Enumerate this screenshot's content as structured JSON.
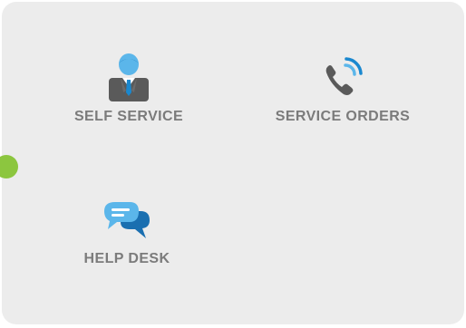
{
  "tiles": [
    {
      "label": "SELF SERVICE",
      "icon": "user-in-suit-icon"
    },
    {
      "label": "SERVICE ORDERS",
      "icon": "phone-call-icon"
    },
    {
      "label": "HELP DESK",
      "icon": "chat-bubbles-icon"
    }
  ],
  "colors": {
    "panel_bg": "#ececec",
    "label": "#7b7b7b",
    "accent_dot": "#8cc63f",
    "icon_blue": "#1a88cf",
    "icon_light_blue": "#5bb6ea",
    "icon_gray": "#5a5a5a"
  }
}
